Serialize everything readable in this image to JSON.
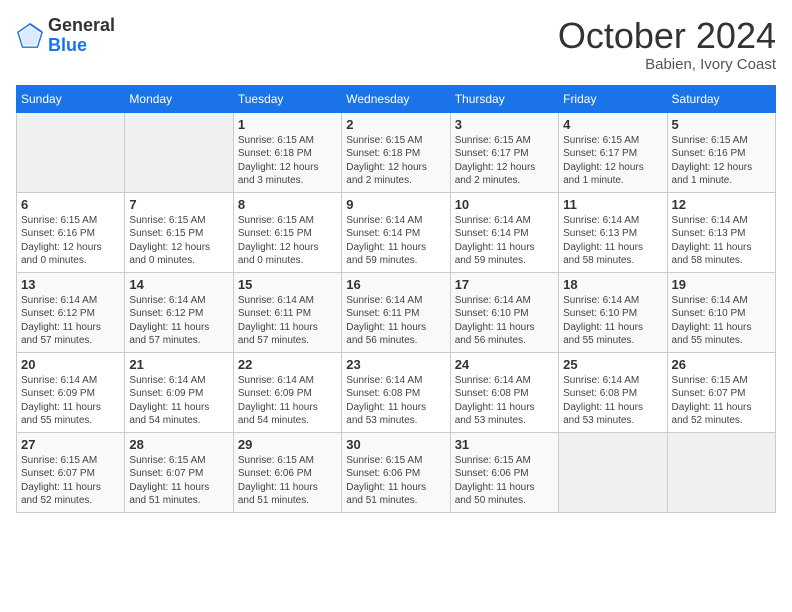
{
  "logo": {
    "general": "General",
    "blue": "Blue"
  },
  "header": {
    "month_year": "October 2024",
    "location": "Babien, Ivory Coast"
  },
  "weekdays": [
    "Sunday",
    "Monday",
    "Tuesday",
    "Wednesday",
    "Thursday",
    "Friday",
    "Saturday"
  ],
  "weeks": [
    [
      {
        "day": "",
        "info": ""
      },
      {
        "day": "",
        "info": ""
      },
      {
        "day": "1",
        "info": "Sunrise: 6:15 AM\nSunset: 6:18 PM\nDaylight: 12 hours\nand 3 minutes."
      },
      {
        "day": "2",
        "info": "Sunrise: 6:15 AM\nSunset: 6:18 PM\nDaylight: 12 hours\nand 2 minutes."
      },
      {
        "day": "3",
        "info": "Sunrise: 6:15 AM\nSunset: 6:17 PM\nDaylight: 12 hours\nand 2 minutes."
      },
      {
        "day": "4",
        "info": "Sunrise: 6:15 AM\nSunset: 6:17 PM\nDaylight: 12 hours\nand 1 minute."
      },
      {
        "day": "5",
        "info": "Sunrise: 6:15 AM\nSunset: 6:16 PM\nDaylight: 12 hours\nand 1 minute."
      }
    ],
    [
      {
        "day": "6",
        "info": "Sunrise: 6:15 AM\nSunset: 6:16 PM\nDaylight: 12 hours\nand 0 minutes."
      },
      {
        "day": "7",
        "info": "Sunrise: 6:15 AM\nSunset: 6:15 PM\nDaylight: 12 hours\nand 0 minutes."
      },
      {
        "day": "8",
        "info": "Sunrise: 6:15 AM\nSunset: 6:15 PM\nDaylight: 12 hours\nand 0 minutes."
      },
      {
        "day": "9",
        "info": "Sunrise: 6:14 AM\nSunset: 6:14 PM\nDaylight: 11 hours\nand 59 minutes."
      },
      {
        "day": "10",
        "info": "Sunrise: 6:14 AM\nSunset: 6:14 PM\nDaylight: 11 hours\nand 59 minutes."
      },
      {
        "day": "11",
        "info": "Sunrise: 6:14 AM\nSunset: 6:13 PM\nDaylight: 11 hours\nand 58 minutes."
      },
      {
        "day": "12",
        "info": "Sunrise: 6:14 AM\nSunset: 6:13 PM\nDaylight: 11 hours\nand 58 minutes."
      }
    ],
    [
      {
        "day": "13",
        "info": "Sunrise: 6:14 AM\nSunset: 6:12 PM\nDaylight: 11 hours\nand 57 minutes."
      },
      {
        "day": "14",
        "info": "Sunrise: 6:14 AM\nSunset: 6:12 PM\nDaylight: 11 hours\nand 57 minutes."
      },
      {
        "day": "15",
        "info": "Sunrise: 6:14 AM\nSunset: 6:11 PM\nDaylight: 11 hours\nand 57 minutes."
      },
      {
        "day": "16",
        "info": "Sunrise: 6:14 AM\nSunset: 6:11 PM\nDaylight: 11 hours\nand 56 minutes."
      },
      {
        "day": "17",
        "info": "Sunrise: 6:14 AM\nSunset: 6:10 PM\nDaylight: 11 hours\nand 56 minutes."
      },
      {
        "day": "18",
        "info": "Sunrise: 6:14 AM\nSunset: 6:10 PM\nDaylight: 11 hours\nand 55 minutes."
      },
      {
        "day": "19",
        "info": "Sunrise: 6:14 AM\nSunset: 6:10 PM\nDaylight: 11 hours\nand 55 minutes."
      }
    ],
    [
      {
        "day": "20",
        "info": "Sunrise: 6:14 AM\nSunset: 6:09 PM\nDaylight: 11 hours\nand 55 minutes."
      },
      {
        "day": "21",
        "info": "Sunrise: 6:14 AM\nSunset: 6:09 PM\nDaylight: 11 hours\nand 54 minutes."
      },
      {
        "day": "22",
        "info": "Sunrise: 6:14 AM\nSunset: 6:09 PM\nDaylight: 11 hours\nand 54 minutes."
      },
      {
        "day": "23",
        "info": "Sunrise: 6:14 AM\nSunset: 6:08 PM\nDaylight: 11 hours\nand 53 minutes."
      },
      {
        "day": "24",
        "info": "Sunrise: 6:14 AM\nSunset: 6:08 PM\nDaylight: 11 hours\nand 53 minutes."
      },
      {
        "day": "25",
        "info": "Sunrise: 6:14 AM\nSunset: 6:08 PM\nDaylight: 11 hours\nand 53 minutes."
      },
      {
        "day": "26",
        "info": "Sunrise: 6:15 AM\nSunset: 6:07 PM\nDaylight: 11 hours\nand 52 minutes."
      }
    ],
    [
      {
        "day": "27",
        "info": "Sunrise: 6:15 AM\nSunset: 6:07 PM\nDaylight: 11 hours\nand 52 minutes."
      },
      {
        "day": "28",
        "info": "Sunrise: 6:15 AM\nSunset: 6:07 PM\nDaylight: 11 hours\nand 51 minutes."
      },
      {
        "day": "29",
        "info": "Sunrise: 6:15 AM\nSunset: 6:06 PM\nDaylight: 11 hours\nand 51 minutes."
      },
      {
        "day": "30",
        "info": "Sunrise: 6:15 AM\nSunset: 6:06 PM\nDaylight: 11 hours\nand 51 minutes."
      },
      {
        "day": "31",
        "info": "Sunrise: 6:15 AM\nSunset: 6:06 PM\nDaylight: 11 hours\nand 50 minutes."
      },
      {
        "day": "",
        "info": ""
      },
      {
        "day": "",
        "info": ""
      }
    ]
  ]
}
